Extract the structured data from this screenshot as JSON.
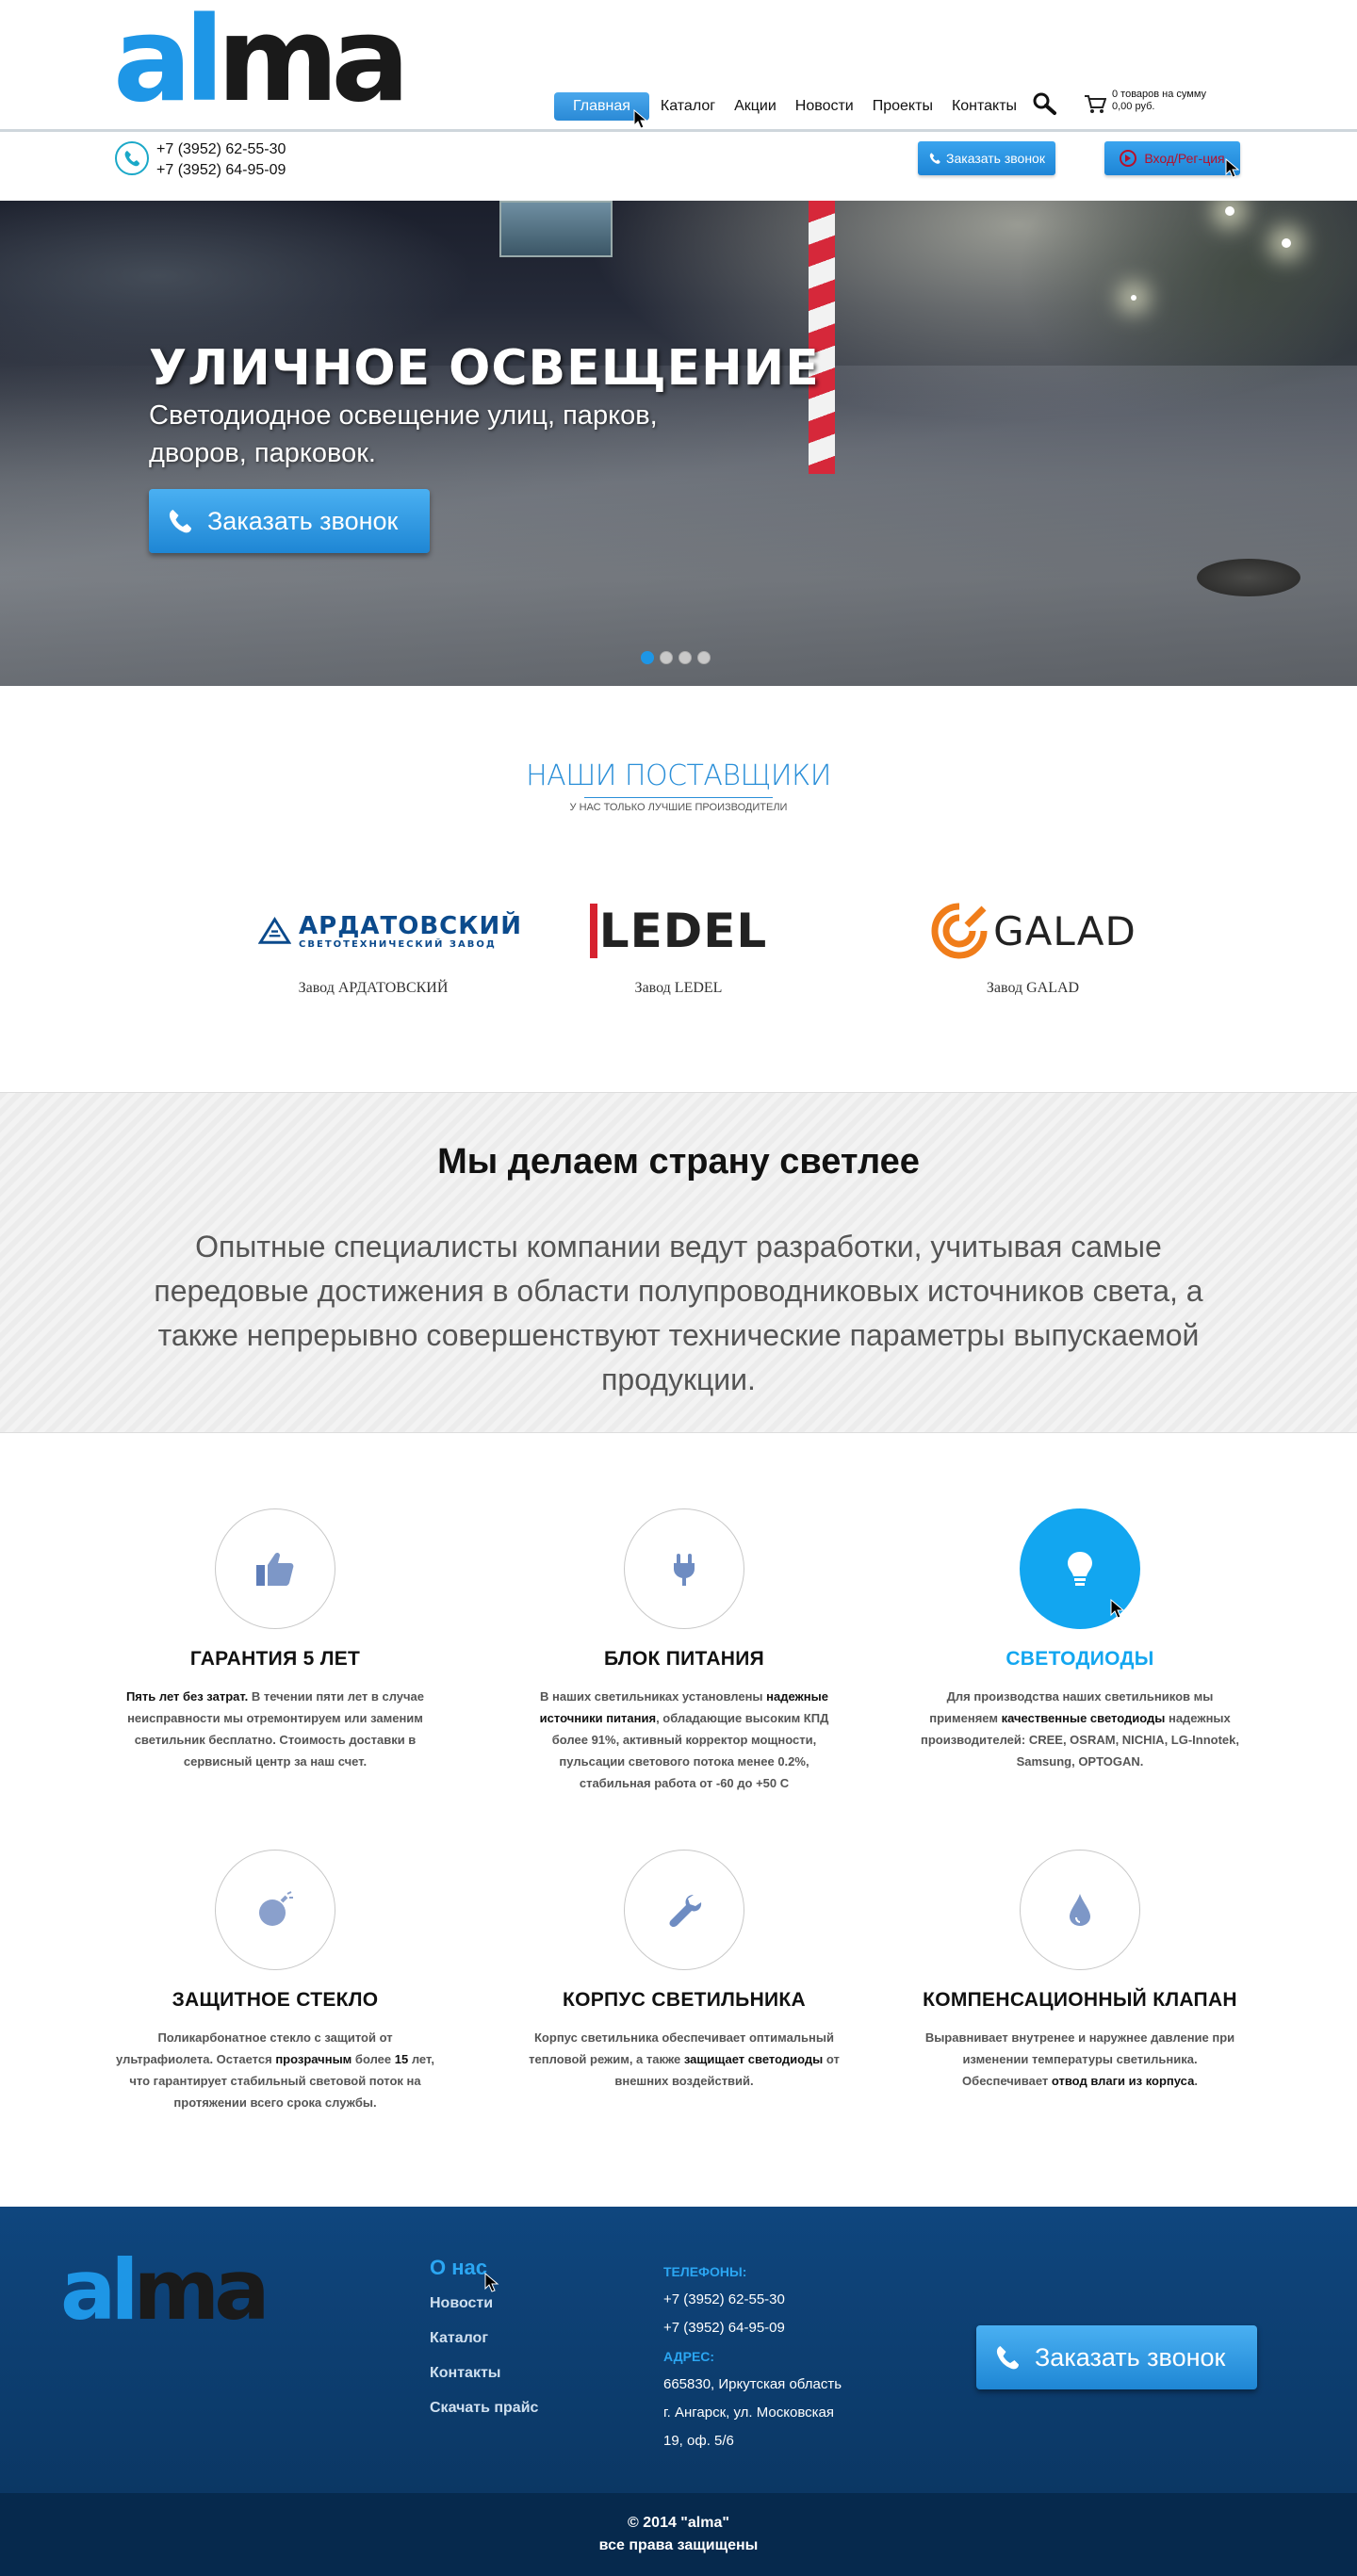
{
  "brand": {
    "logo_part1": "al",
    "logo_part2": "ma"
  },
  "nav": {
    "items": [
      {
        "label": "Главная",
        "active": true
      },
      {
        "label": "Каталог"
      },
      {
        "label": "Акции"
      },
      {
        "label": "Новости"
      },
      {
        "label": "Проекты"
      },
      {
        "label": "Контакты"
      }
    ]
  },
  "cart": {
    "line1": "0 товаров на сумму",
    "line2": "0,00 руб.",
    "icon": "cart-icon"
  },
  "phones": [
    "+7 (3952) 62-55-30",
    "+7 (3952) 64-95-09"
  ],
  "buttons": {
    "call_small": "Заказать звонок",
    "login": "Вход/Рег-ция"
  },
  "hero": {
    "title": "УЛИЧНОЕ ОСВЕЩЕНИЕ",
    "subtitle": "Светодиодное освещение улиц, парков, дворов, парковок.",
    "button": "Заказать звонок",
    "slides": 4,
    "active_slide": 1
  },
  "suppliers": {
    "title": "НАШИ ПОСТАВЩИКИ",
    "subtitle": "У НАС ТОЛЬКО ЛУЧШИЕ ПРОИЗВОДИТЕЛИ",
    "items": [
      {
        "logo_main": "АРДАТОВСКИЙ",
        "logo_sub": "СВЕТОТЕХНИЧЕСКИЙ ЗАВОД",
        "caption": "Завод АРДАТОВСКИЙ"
      },
      {
        "logo_main": "LEDEL",
        "caption": "Завод LEDEL"
      },
      {
        "logo_main": "GALAD",
        "caption": "Завод GALAD"
      }
    ]
  },
  "motto": {
    "title": "Мы делаем страну светлее",
    "text": "Опытные специалисты компании ведут разработки, учитывая самые передовые достижения в области полупроводниковых источников света, а также непрерывно совершенствуют технические параметры выпускаемой продукции."
  },
  "features": [
    {
      "icon": "thumbs-up-icon",
      "title": "ГАРАНТИЯ 5 ЛЕТ",
      "bold": "Пять лет без затрат.",
      "text": " В течении пяти лет в случае неисправности мы отремонтируем или заменим светильник бесплатно. Стоимость доставки в сервисный центр за наш счет."
    },
    {
      "icon": "plug-icon",
      "title": "БЛОК ПИТАНИЯ",
      "pre": "В наших светильниках установлены ",
      "bold": "надежные источники питания",
      "text": ", обладающие высоким КПД более 91%, активный корректор мощности, пульсации светового потока менее 0.2%, стабильная работа от -60 до +50 С"
    },
    {
      "icon": "lightbulb-icon",
      "title": "СВЕТОДИОДЫ",
      "active": true,
      "pre": "Для производства наших светильников мы применяем ",
      "bold": "качественные светодиоды",
      "text": " надежных производителей: CREE, OSRAM, NICHIA, LG-Innotek, Samsung, OPTOGAN."
    },
    {
      "icon": "bomb-icon",
      "title": "ЗАЩИТНОЕ СТЕКЛО",
      "pre": "Поликарбонатное стекло с защитой от ультрафиолета. Остается ",
      "bold": "прозрачным",
      "mid": " более ",
      "bold2": "15",
      "text": " лет, что гарантирует стабильный световой поток на протяжении всего срока службы."
    },
    {
      "icon": "wrench-icon",
      "title": "КОРПУС СВЕТИЛЬНИКА",
      "pre": "Корпус светильника обеспечивает оптимальный тепловой режим, а также ",
      "bold": "защищает светодиоды",
      "text": " от внешних воздействий."
    },
    {
      "icon": "water-drop-icon",
      "title": "КОМПЕНСАЦИОННЫЙ КЛАПАН",
      "pre": "Выравнивает внутренее и наружнее давление при изменении температуры светильника. Обеспечивает ",
      "bold": "отвод влаги из корпуса",
      "text": "."
    }
  ],
  "footer": {
    "nav_title": "О нас",
    "nav_items": [
      "Новости",
      "Каталог",
      "Контакты",
      "Скачать прайс"
    ],
    "phones_label": "ТЕЛЕФОНЫ:",
    "phones": [
      "+7 (3952) 62-55-30",
      "+7 (3952) 64-95-09"
    ],
    "address_label": "АДРЕС:",
    "address_lines": [
      "665830, Иркутская область",
      "г. Ангарск, ул. Московская",
      "19, оф. 5/6"
    ],
    "button": "Заказать звонок"
  },
  "copyright": {
    "line1": "© 2014 \"alma\"",
    "line2": "все права защищены"
  },
  "colors": {
    "accent": "#1e96e6",
    "footer_bg": "#0f467e",
    "copyright_bg": "#06294d",
    "active_feature": "#12a6f0"
  }
}
